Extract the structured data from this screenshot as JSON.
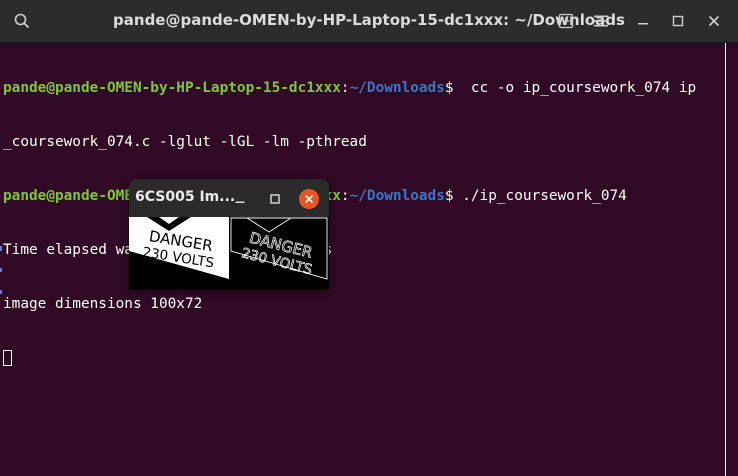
{
  "window": {
    "title": "pande@pande-OMEN-by-HP-Laptop-15-dc1xxx: ~/Downloads",
    "search_icon": "search-icon",
    "new_tab_icon": "new-tab-icon",
    "menu_icon": "hamburger-menu-icon",
    "minimize_icon": "minimize-icon",
    "maximize_icon": "maximize-icon",
    "close_icon": "close-icon"
  },
  "terminal": {
    "prompt1_user": "pande@pande-OMEN-by-HP-Laptop-15-dc1xxx",
    "prompt1_sep": ":",
    "prompt1_path": "~/Downloads",
    "prompt1_dollar": "$ ",
    "command1_a": " cc -o ip_coursework_074 ip",
    "command1_b": "_coursework_074.c -lglut -lGL -lm -pthread",
    "prompt2_user": "pande@pande-OMEN-by-HP-Laptop-15-dc1xxx",
    "prompt2_sep": ":",
    "prompt2_path": "~/Downloads",
    "prompt2_dollar": "$ ",
    "command2": "./ip_coursework_074",
    "output1": "Time elapsed was 203ns or 0.000000203s",
    "output2": "image dimensions 100x72"
  },
  "popup": {
    "title": "6CS005 Im...",
    "minimize_icon": "minimize-icon",
    "maximize_icon": "maximize-icon",
    "close_icon": "close-icon",
    "image_text_line1": "DANGER",
    "image_text_line2": "230 VOLTS"
  },
  "colors": {
    "terminal_bg": "#300a24",
    "user_green": "#7fc82f",
    "path_blue": "#3c77c6",
    "close_orange": "#e95420",
    "titlebar": "#2c2c2c"
  }
}
